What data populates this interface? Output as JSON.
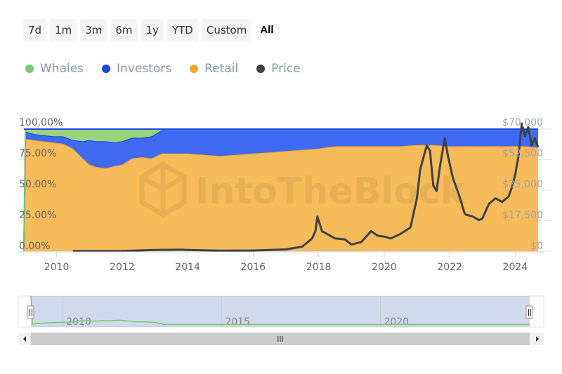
{
  "range_selector": {
    "buttons": [
      "7d",
      "1m",
      "3m",
      "6m",
      "1y",
      "YTD",
      "Custom",
      "All"
    ],
    "selected": "All"
  },
  "legend": [
    {
      "name": "Whales",
      "color": "#7ac96a"
    },
    {
      "name": "Investors",
      "color": "#1447f5"
    },
    {
      "name": "Retail",
      "color": "#f6a623"
    },
    {
      "name": "Price",
      "color": "#3d4247"
    }
  ],
  "watermark": "IntoTheBlock",
  "chart_data": {
    "type": "area",
    "title": "",
    "stacking": "percent",
    "x_ticks": [
      "2010",
      "2012",
      "2014",
      "2016",
      "2018",
      "2020",
      "2022",
      "2024"
    ],
    "x_range": [
      2009.0,
      2024.7
    ],
    "y_left": {
      "ticks": [
        "0.00%",
        "25.00%",
        "50.00%",
        "75.00%",
        "100.00%"
      ],
      "range": [
        0,
        100
      ]
    },
    "y_right": {
      "ticks": [
        "$0",
        "$17,500",
        "$35,000",
        "$52,500",
        "$70,000"
      ],
      "range": [
        0,
        70000
      ]
    },
    "x": [
      2009.0,
      2009.05,
      2009.3,
      2009.6,
      2009.9,
      2010.2,
      2010.5,
      2010.8,
      2011.0,
      2011.2,
      2011.5,
      2011.8,
      2012.0,
      2012.3,
      2012.6,
      2012.9,
      2013.2,
      2013.6,
      2014.0,
      2014.5,
      2015.0,
      2015.5,
      2016.0,
      2016.5,
      2017.0,
      2017.5,
      2018.0,
      2018.5,
      2019.0,
      2019.5,
      2020.0,
      2020.5,
      2021.0,
      2021.5,
      2022.0,
      2022.5,
      2023.0,
      2023.5,
      2024.0,
      2024.3,
      2024.7
    ],
    "series": [
      {
        "name": "Retail",
        "values": [
          0,
          92,
          91,
          90,
          89,
          88,
          84,
          76,
          71,
          69,
          68,
          70,
          71,
          76,
          77,
          76,
          80,
          80,
          80,
          79,
          78,
          79,
          80,
          81,
          82,
          83,
          84,
          86,
          86,
          86,
          86,
          86,
          87,
          87,
          86,
          86,
          86,
          86,
          86,
          86,
          85
        ]
      },
      {
        "name": "Investors",
        "values": [
          0,
          6,
          5,
          5,
          5,
          6,
          7,
          14,
          20,
          21,
          22,
          19,
          19,
          17,
          16,
          18,
          19,
          19,
          19,
          20,
          21,
          20,
          19,
          18,
          17,
          16,
          15,
          13,
          13,
          13,
          13,
          13,
          12,
          12,
          13,
          13,
          13,
          13,
          13,
          13,
          14
        ]
      },
      {
        "name": "Whales",
        "values": [
          0,
          2,
          4,
          5,
          6,
          6,
          9,
          10,
          9,
          10,
          10,
          11,
          10,
          7,
          7,
          6,
          1,
          1,
          1,
          1,
          1,
          1,
          1,
          1,
          1,
          1,
          1,
          1,
          1,
          1,
          1,
          1,
          1,
          1,
          1,
          1,
          1,
          1,
          1,
          1,
          1
        ]
      }
    ],
    "price": {
      "name": "Price",
      "x": [
        2010.5,
        2012.0,
        2013.0,
        2013.8,
        2014.0,
        2015.0,
        2016.0,
        2016.5,
        2017.0,
        2017.5,
        2017.8,
        2017.9,
        2017.96,
        2018.1,
        2018.3,
        2018.5,
        2018.8,
        2019.0,
        2019.3,
        2019.5,
        2019.6,
        2019.8,
        2020.0,
        2020.2,
        2020.5,
        2020.8,
        2021.0,
        2021.1,
        2021.3,
        2021.4,
        2021.5,
        2021.6,
        2021.7,
        2021.85,
        2021.95,
        2022.1,
        2022.3,
        2022.45,
        2022.5,
        2022.7,
        2022.9,
        2023.0,
        2023.2,
        2023.4,
        2023.6,
        2023.8,
        2023.9,
        2024.0,
        2024.1,
        2024.2,
        2024.3,
        2024.4,
        2024.5,
        2024.6,
        2024.7
      ],
      "values": [
        100,
        100,
        700,
        800,
        700,
        300,
        400,
        650,
        1000,
        2500,
        7000,
        11000,
        19000,
        11000,
        9000,
        7000,
        6500,
        3700,
        5000,
        9000,
        11000,
        8500,
        8000,
        7000,
        9500,
        13000,
        29000,
        45000,
        58000,
        55000,
        36000,
        33000,
        46000,
        62000,
        52000,
        40000,
        30000,
        21000,
        20000,
        19000,
        17000,
        18000,
        26000,
        29000,
        27000,
        30000,
        35000,
        42000,
        52000,
        70000,
        63000,
        68000,
        58000,
        62000,
        57000
      ]
    }
  },
  "navigator": {
    "labels": [
      "2010",
      "2015",
      "2020"
    ],
    "scrollbar_grip": "III"
  }
}
